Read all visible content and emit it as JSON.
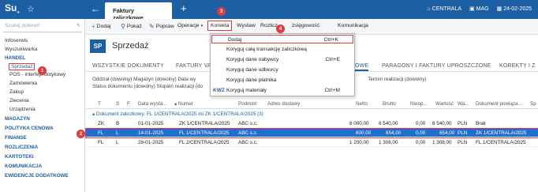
{
  "topbar": {
    "logo": "Su",
    "tab_title": "Faktury zaliczkowe",
    "centrala": "CENTRALA",
    "mag": "MAG",
    "date": "24-02-2025"
  },
  "sidebar": {
    "search_placeholder": "Szukaj poleceń",
    "items": [
      {
        "label": "Infoserwis",
        "type": "item"
      },
      {
        "label": "Wyszukiwarka",
        "type": "item"
      },
      {
        "label": "HANDEL",
        "type": "head"
      },
      {
        "label": "Sprzedaż",
        "type": "active"
      },
      {
        "label": "POS - interfejs dotykowy",
        "type": "sub"
      },
      {
        "label": "Zamówienia",
        "type": "sub"
      },
      {
        "label": "Zakup",
        "type": "sub"
      },
      {
        "label": "Zlecenia",
        "type": "sub"
      },
      {
        "label": "Urządzenia",
        "type": "sub"
      },
      {
        "label": "MAGAZYN",
        "type": "head"
      },
      {
        "label": "POLITYKA CENOWA",
        "type": "head"
      },
      {
        "label": "FINANSE",
        "type": "head"
      },
      {
        "label": "ROZLICZENIA",
        "type": "head"
      },
      {
        "label": "KARTOTEKI",
        "type": "head"
      },
      {
        "label": "KOMUNIKACJA",
        "type": "head"
      },
      {
        "label": "EWIDENCJE DODATKOWE",
        "type": "head"
      }
    ]
  },
  "toolbar": {
    "dodaj": "Dodaj",
    "pokaz": "Pokaż",
    "popraw": "Popraw",
    "operacje": "Operacje",
    "korekta": "Korekta",
    "wystaw": "Wystaw",
    "rozliczenia": "Rozlicz",
    "rozliczenia_tail": "żsięgowość",
    "komunikacja": "Komunikacja"
  },
  "header": {
    "badge": "SP",
    "title": "Sprzedaż"
  },
  "category_tabs": {
    "all": "WSZYSTKIE DOKUMENTY",
    "faktury": "FAKTURY VA",
    "zaliczkowe": "OWE",
    "paragony": "PARAGONY I FAKTURY UPROSZCZONE",
    "korekty": "KOREKTY I Z"
  },
  "filters": {
    "line1a": "Oddział (dowolny)  Magazyn (dowolny)  Data wy",
    "line1b": "Termin realizacji (dowolny)",
    "line2": "Status dokumentu (dowolny)  Stopień realizacji (do"
  },
  "grid": {
    "headers": [
      "T",
      "S",
      "F",
      "Data wysta...",
      "Numer",
      "Podmiot",
      "Adres dostawy",
      "Netto",
      "Brutto",
      "Nieop...",
      "Wartość",
      "Wa...",
      "Dokument powiąza...",
      "Sp"
    ],
    "group_label": "Dokument zaliczkowy: FL 1/CENTRALA/2025 do ZK 1/CENTRALA/2025 (3)",
    "rows": [
      {
        "t": "ZK",
        "s": "B",
        "f": "",
        "date": "01-01-2025",
        "numer": "ZK 1/CENTRALA/2025",
        "podmiot": "ABC s.c.",
        "netto": "6 000,00",
        "brutto": "6 540,00",
        "nieop": "0,00",
        "wartosc": "6 540,00",
        "waluta": "PLN",
        "powiazany": "Brak"
      },
      {
        "t": "FL",
        "s": "L",
        "f": "",
        "date": "14-01-2025",
        "numer": "FL 1/CENTRALA/2025",
        "podmiot": "ABC s.c.",
        "netto": "600,00",
        "brutto": "654,00",
        "nieop": "0,00",
        "wartosc": "654,00",
        "waluta": "PLN",
        "powiazany": "ZK 1/CENTRALA/2025"
      },
      {
        "t": "FL",
        "s": "L",
        "f": "",
        "date": "28-01-2025",
        "numer": "FL 2/CENTRALA/2025",
        "podmiot": "ABC s.c.",
        "netto": "1 200,00",
        "brutto": "1 308,00",
        "nieop": "0,00",
        "wartosc": "1 308,00",
        "waluta": "PLN",
        "powiazany": "FL 1/CENTRALA/2025"
      }
    ]
  },
  "dropdown": {
    "items": [
      {
        "label": "Dodaj",
        "shortcut": "Ctrl+K"
      },
      {
        "label": "Koryguj całą transakcję zaliczkową",
        "shortcut": ""
      },
      {
        "label": "Koryguj dane nabywcy",
        "shortcut": "Ctrl+E"
      },
      {
        "label": "Koryguj dane odbiorcy",
        "shortcut": ""
      },
      {
        "label": "Koryguj dane płatnika",
        "shortcut": ""
      },
      {
        "label": "Koryguj materiały",
        "shortcut": "Ctrl+M"
      }
    ],
    "kwz_label": "KWZ"
  },
  "callouts": [
    "1",
    "2",
    "3",
    "4"
  ]
}
